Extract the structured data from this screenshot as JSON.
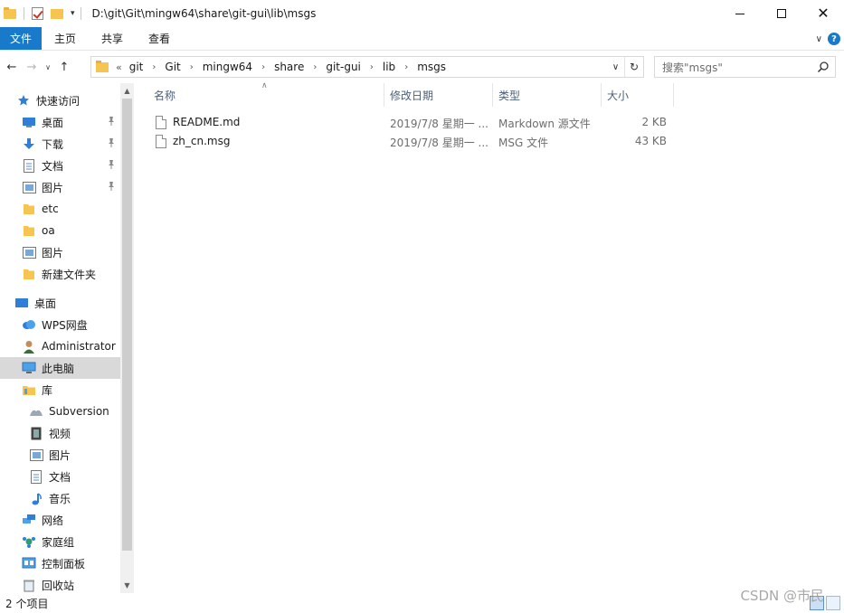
{
  "window": {
    "title": "D:\\git\\Git\\mingw64\\share\\git-gui\\lib\\msgs"
  },
  "ribbon": {
    "tabs": [
      {
        "label": "文件"
      },
      {
        "label": "主页"
      },
      {
        "label": "共享"
      },
      {
        "label": "查看"
      }
    ]
  },
  "address": {
    "lead": "«",
    "crumbs": [
      "git",
      "Git",
      "mingw64",
      "share",
      "git-gui",
      "lib",
      "msgs"
    ]
  },
  "search": {
    "placeholder": "搜索\"msgs\""
  },
  "nav": {
    "quick_access": "快速访问",
    "items": [
      {
        "label": "桌面",
        "icon": "desktop-icon",
        "pinned": true
      },
      {
        "label": "下载",
        "icon": "download-icon",
        "pinned": true
      },
      {
        "label": "文档",
        "icon": "documents-icon",
        "pinned": true
      },
      {
        "label": "图片",
        "icon": "pictures-icon",
        "pinned": true
      },
      {
        "label": "etc",
        "icon": "folder-icon",
        "pinned": false
      },
      {
        "label": "oa",
        "icon": "folder-icon",
        "pinned": false
      },
      {
        "label": "图片",
        "icon": "pictures-icon",
        "pinned": false
      },
      {
        "label": "新建文件夹",
        "icon": "folder-icon",
        "pinned": false
      }
    ],
    "tree": [
      {
        "label": "桌面",
        "icon": "desktop-icon"
      },
      {
        "label": "WPS网盘",
        "icon": "cloud-icon"
      },
      {
        "label": "Administrator",
        "icon": "user-icon"
      },
      {
        "label": "此电脑",
        "icon": "computer-icon"
      },
      {
        "label": "库",
        "icon": "library-icon"
      },
      {
        "label": "Subversion",
        "icon": "subversion-icon"
      },
      {
        "label": "视频",
        "icon": "video-icon"
      },
      {
        "label": "图片",
        "icon": "pictures-icon"
      },
      {
        "label": "文档",
        "icon": "documents-icon"
      },
      {
        "label": "音乐",
        "icon": "music-icon"
      },
      {
        "label": "网络",
        "icon": "network-icon"
      },
      {
        "label": "家庭组",
        "icon": "homegroup-icon"
      },
      {
        "label": "控制面板",
        "icon": "control-panel-icon"
      },
      {
        "label": "回收站",
        "icon": "recycle-bin-icon"
      }
    ],
    "selected": "此电脑"
  },
  "columns": {
    "name": "名称",
    "date": "修改日期",
    "type": "类型",
    "size": "大小"
  },
  "files": [
    {
      "name": "README.md",
      "date": "2019/7/8 星期一 ...",
      "type": "Markdown 源文件",
      "size": "2 KB"
    },
    {
      "name": "zh_cn.msg",
      "date": "2019/7/8 星期一 ...",
      "type": "MSG 文件",
      "size": "43 KB"
    }
  ],
  "status": {
    "count": "2 个项目"
  },
  "watermark": "CSDN @市民",
  "colors": {
    "accent": "#1979ca",
    "folder": "#f5c451",
    "selected_row": "#d9d9d9"
  }
}
